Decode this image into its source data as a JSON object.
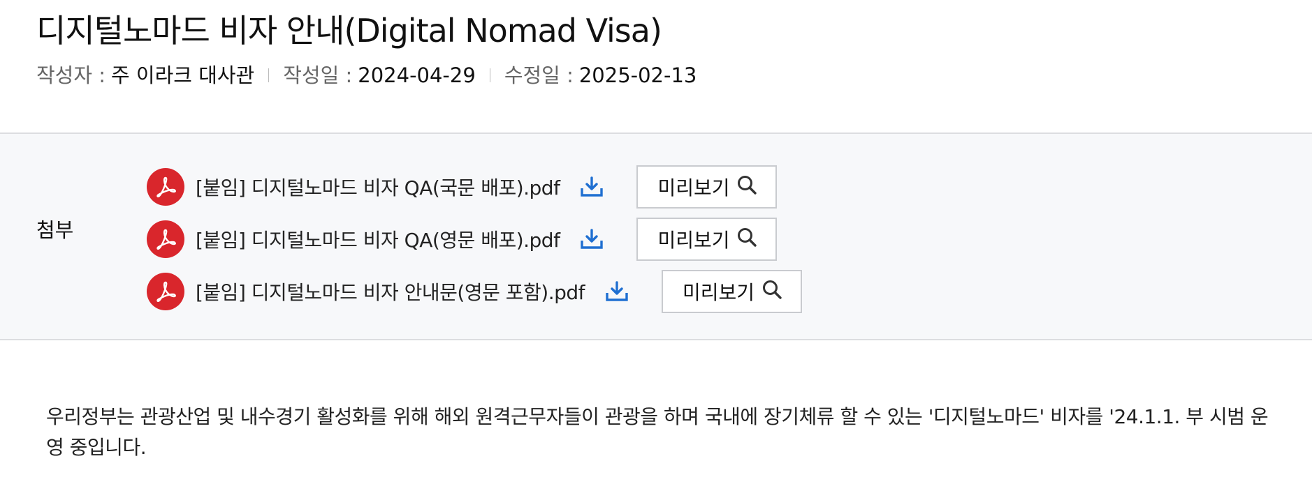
{
  "post": {
    "title": "디지털노마드 비자 안내(Digital Nomad Visa)",
    "meta": {
      "author_label": "작성자 :",
      "author": "주 이라크 대사관",
      "created_label": "작성일 :",
      "created": "2024-04-29",
      "modified_label": "수정일 :",
      "modified": "2025-02-13"
    }
  },
  "attachments": {
    "label": "첨부",
    "preview_label": "미리보기",
    "files": [
      {
        "name": "[붙임] 디지털노마드 비자 QA(국문 배포).pdf"
      },
      {
        "name": "[붙임] 디지털노마드 비자 QA(영문 배포).pdf"
      },
      {
        "name": "[붙임] 디지털노마드 비자 안내문(영문 포함).pdf"
      }
    ]
  },
  "content": {
    "paragraph_1": "우리정부는 관광산업 및 내수경기 활성화를 위해 해외 원격근무자들이 관광을 하며 국내에 장기체류 할 수 있는 '디지털노마드' 비자를 '24.1.1. 부 시범 운영 중입니다."
  },
  "colors": {
    "pdf_icon": "#d9262c",
    "download_icon": "#1f6fd1",
    "attach_bg": "#f7f8fa"
  },
  "icons": [
    "pdf-icon",
    "download-icon",
    "search-icon"
  ]
}
